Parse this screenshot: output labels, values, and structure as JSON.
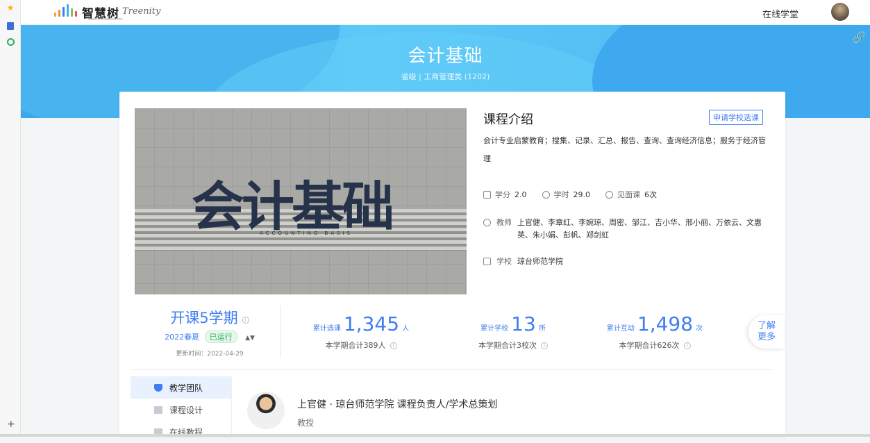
{
  "topbar": {
    "logo_text": "智慧树",
    "logo_url": "www.zhihuishu.com",
    "logo_secondary": "Treenity",
    "nav_online": "在线学堂"
  },
  "rail": {
    "icons": [
      "star-icon",
      "book-icon",
      "clock-icon",
      "plus-icon"
    ],
    "plus": "+"
  },
  "hero": {
    "title": "会计基础",
    "subtitle": "省级 | 工商管理类 (1202)",
    "link_icon": "🔗"
  },
  "cover": {
    "word": "会计基础",
    "sub": "ACCOUNTING BASIS"
  },
  "intro": {
    "title": "课程介绍",
    "apply_label": "申请学校选课",
    "desc": "会计专业启蒙教育；搜集、记录、汇总、报告、查询、查询经济信息；服务于经济管理",
    "credit_label": "学分",
    "credit_value": "2.0",
    "hours_label": "学时",
    "hours_value": "29.0",
    "meet_label": "见面课",
    "meet_value": "6次",
    "teacher_label": "教师",
    "teachers": "上官健、李章红、李婉琼、周密、邹江、吉小华、邢小丽、万依云、文惠英、朱小娟、彭帆、郑剑虹",
    "school_label": "学校",
    "school_value": "琼台师范学院"
  },
  "stats": {
    "terms": "开课5学期",
    "term_name": "2022春夏",
    "term_status": "已运行",
    "updated": "更新时间：2022-04-29",
    "selections_label": "累计选课",
    "selections_num": "1,345",
    "selections_unit": "人",
    "selections_sub": "本学期合计389人",
    "schools_label": "累计学校",
    "schools_num": "13",
    "schools_unit": "所",
    "schools_sub": "本学期合计3校次",
    "interact_label": "累计互动",
    "interact_num": "1,498",
    "interact_unit": "次",
    "interact_sub": "本学期合计626次",
    "more_label_1": "了解",
    "more_label_2": "更多"
  },
  "side_nav": {
    "items": [
      {
        "label": "教学团队"
      },
      {
        "label": "课程设计"
      },
      {
        "label": "在线教程"
      }
    ]
  },
  "teacher": {
    "name_line": "上官健 · 琼台师范学院    课程负责人/学术总策划",
    "title": "教授"
  },
  "colors": {
    "accent": "#3f7ef0",
    "hero": "#4cb6f2",
    "status_green": "#2fb463"
  }
}
